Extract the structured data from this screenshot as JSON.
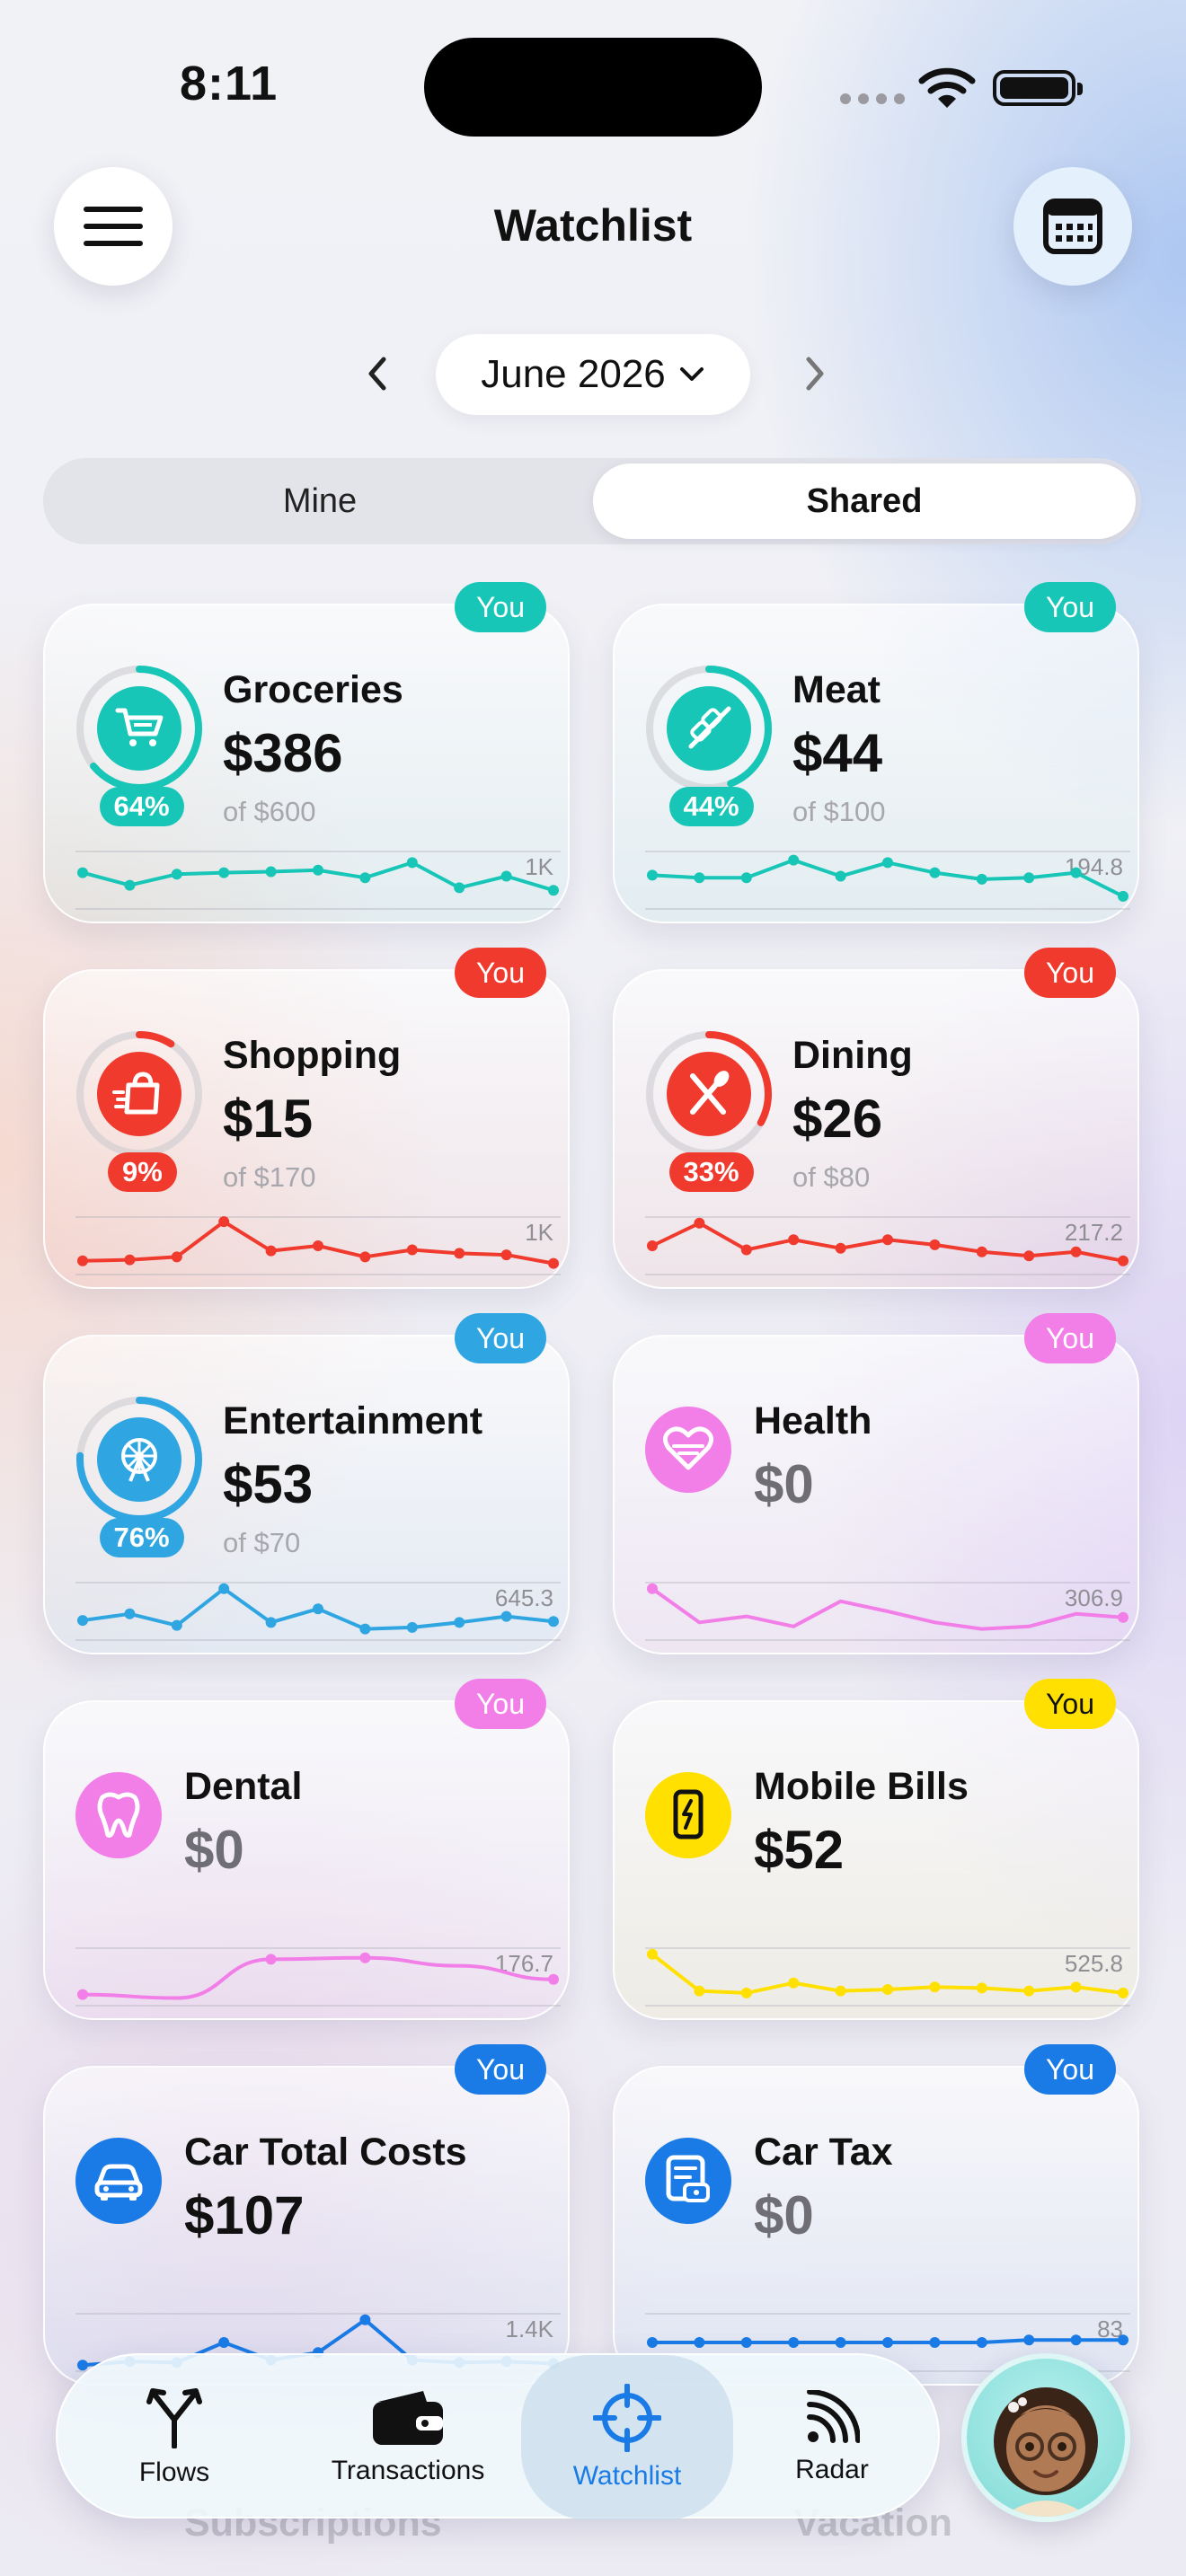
{
  "status_bar": {
    "time": "8:11"
  },
  "header": {
    "title": "Watchlist",
    "menu_icon": "hamburger-icon",
    "calendar_icon": "calendar-icon"
  },
  "period": {
    "label": "June 2026"
  },
  "segments": {
    "mine": "Mine",
    "shared": "Shared",
    "selected": "Shared"
  },
  "colors": {
    "teal": "#17c6b6",
    "red": "#f03a2e",
    "blue": "#2fa6e2",
    "pink": "#f27ee8",
    "yellow": "#ffe000",
    "navy": "#1a7be6"
  },
  "cards": [
    {
      "name": "Groceries",
      "amount": "$386",
      "of": "of $600",
      "pct": "64%",
      "pct_value": 0.64,
      "max": "1K",
      "badge": "You",
      "color": "#17c6b6",
      "icon": "cart-icon",
      "spark": [
        0.35,
        0.6,
        0.38,
        0.35,
        0.33,
        0.3,
        0.45,
        0.15,
        0.65,
        0.42,
        0.7
      ]
    },
    {
      "name": "Meat",
      "amount": "$44",
      "of": "of $100",
      "pct": "44%",
      "pct_value": 0.44,
      "max": "194.8",
      "badge": "You",
      "color": "#17c6b6",
      "icon": "skewer-icon",
      "spark": [
        0.4,
        0.45,
        0.45,
        0.1,
        0.42,
        0.15,
        0.35,
        0.48,
        0.45,
        0.35,
        0.82
      ]
    },
    {
      "name": "Shopping",
      "amount": "$15",
      "of": "of $170",
      "pct": "9%",
      "pct_value": 0.09,
      "max": "1K",
      "badge": "You",
      "color": "#f03a2e",
      "icon": "shopping-bag-icon",
      "spark": [
        0.8,
        0.78,
        0.72,
        0.02,
        0.6,
        0.5,
        0.72,
        0.58,
        0.65,
        0.68,
        0.85
      ]
    },
    {
      "name": "Dining",
      "amount": "$26",
      "of": "of $80",
      "pct": "33%",
      "pct_value": 0.33,
      "max": "217.2",
      "badge": "You",
      "color": "#f03a2e",
      "icon": "fork-knife-icon",
      "spark": [
        0.5,
        0.05,
        0.58,
        0.38,
        0.55,
        0.38,
        0.48,
        0.62,
        0.7,
        0.62,
        0.8
      ]
    },
    {
      "name": "Entertainment",
      "amount": "$53",
      "of": "of $70",
      "pct": "76%",
      "pct_value": 0.76,
      "max": "645.3",
      "badge": "You",
      "color": "#2fa6e2",
      "icon": "ferris-wheel-icon",
      "spark": [
        0.68,
        0.55,
        0.78,
        0.05,
        0.72,
        0.45,
        0.85,
        0.82,
        0.72,
        0.6,
        0.7
      ]
    },
    {
      "name": "Health",
      "amount": "$0",
      "of": "",
      "pct": "",
      "pct_value": null,
      "max": "306.9",
      "badge": "You",
      "color": "#f27ee8",
      "icon": "heart-icon",
      "spark": [
        0.05,
        0.72,
        0.6,
        0.8,
        0.3,
        0.5,
        0.72,
        0.85,
        0.8,
        0.55,
        0.62
      ]
    },
    {
      "name": "Dental",
      "amount": "$0",
      "of": "",
      "pct": "",
      "pct_value": null,
      "max": "176.7",
      "badge": "You",
      "color": "#f27ee8",
      "icon": "tooth-icon",
      "spark": [
        0.85,
        0.92,
        0.15,
        0.12,
        0.28,
        0.55
      ]
    },
    {
      "name": "Mobile Bills",
      "amount": "$52",
      "of": "",
      "pct": "",
      "pct_value": null,
      "max": "525.8",
      "badge": "You",
      "color": "#ffe000",
      "icon": "phone-bolt-icon",
      "spark": [
        0.05,
        0.78,
        0.82,
        0.62,
        0.78,
        0.75,
        0.7,
        0.72,
        0.78,
        0.7,
        0.82
      ]
    },
    {
      "name": "Car Total Costs",
      "amount": "$107",
      "of": "",
      "pct": "",
      "pct_value": null,
      "max": "1.4K",
      "badge": "You",
      "color": "#1a7be6",
      "icon": "car-icon",
      "spark": [
        0.95,
        0.88,
        0.9,
        0.5,
        0.85,
        0.7,
        0.05,
        0.85,
        0.9,
        0.88,
        0.92
      ]
    },
    {
      "name": "Car Tax",
      "amount": "$0",
      "of": "",
      "pct": "",
      "pct_value": null,
      "max": "83",
      "badge": "You",
      "color": "#1a7be6",
      "icon": "car-document-icon",
      "spark": [
        0.5,
        0.5,
        0.5,
        0.5,
        0.5,
        0.5,
        0.5,
        0.5,
        0.45,
        0.45,
        0.45
      ]
    }
  ],
  "ghost_cards": [
    "Subscriptions",
    "Vacation"
  ],
  "nav": {
    "items": [
      {
        "label": "Flows",
        "icon": "fork-arrows-icon"
      },
      {
        "label": "Transactions",
        "icon": "wallet-icon"
      },
      {
        "label": "Watchlist",
        "icon": "crosshair-icon",
        "active": true
      },
      {
        "label": "Radar",
        "icon": "signal-icon"
      }
    ],
    "avatar": "avatar"
  }
}
